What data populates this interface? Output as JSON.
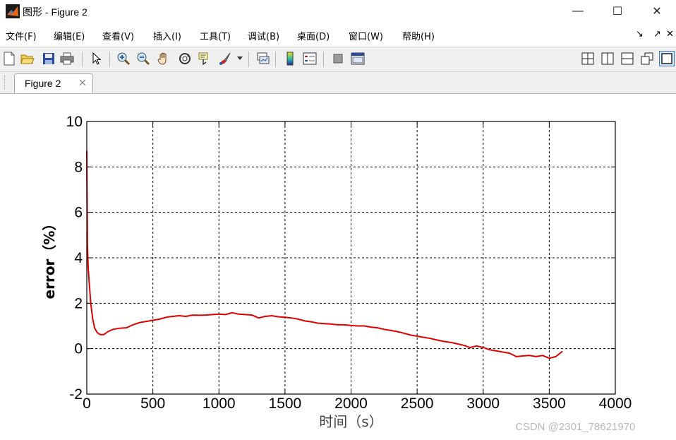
{
  "window": {
    "title": "图形 - Figure 2",
    "minimize_label": "—",
    "maximize_label": "☐",
    "close_label": "✕"
  },
  "menu": {
    "items": [
      "文件(F)",
      "编辑(E)",
      "查看(V)",
      "插入(I)",
      "工具(T)",
      "调试(B)",
      "桌面(D)",
      "窗口(W)",
      "帮助(H)"
    ],
    "right_icons": [
      "↘",
      "↗",
      "✕"
    ]
  },
  "toolbar": {
    "buttons": [
      "new-figure-icon",
      "open-file-icon",
      "save-icon",
      "print-icon",
      "edit-plot-icon",
      "zoom-in-icon",
      "zoom-out-icon",
      "pan-icon",
      "rotate-3d-icon",
      "data-cursor-icon",
      "brush-icon",
      "dropdown-arrow-icon",
      "link-plot-icon",
      "colorbar-icon",
      "legend-icon",
      "hide-plot-tools-icon",
      "show-plot-tools-icon"
    ],
    "layout_buttons": [
      "tile-icon",
      "left-right-icon",
      "top-bottom-icon",
      "float-icon",
      "maximize-icon"
    ]
  },
  "tab": {
    "label": "Figure 2",
    "close_label": "✕"
  },
  "watermark": "CSDN @2301_78621970",
  "chart_data": {
    "type": "line",
    "title": "",
    "xlabel": "时间（s）",
    "ylabel": "error（%）",
    "xlim": [
      0,
      4000
    ],
    "ylim": [
      -2,
      10
    ],
    "xticks": [
      0,
      500,
      1000,
      1500,
      2000,
      2500,
      3000,
      3500,
      4000
    ],
    "yticks": [
      -2,
      0,
      2,
      4,
      6,
      8,
      10
    ],
    "grid": true,
    "grid_style": "dashed",
    "line_color": "#e00000",
    "series": [
      {
        "x": [
          0,
          5,
          10,
          20,
          30,
          45,
          60,
          80,
          100,
          130,
          160,
          200,
          250,
          300,
          350,
          400,
          450,
          500,
          550,
          600,
          650,
          700,
          750,
          800,
          850,
          900,
          950,
          1000,
          1050,
          1100,
          1150,
          1200,
          1250,
          1300,
          1350,
          1400,
          1450,
          1500,
          1550,
          1600,
          1650,
          1700,
          1750,
          1800,
          1850,
          1900,
          1950,
          2000,
          2050,
          2100,
          2150,
          2200,
          2250,
          2300,
          2350,
          2400,
          2450,
          2500,
          2550,
          2600,
          2650,
          2700,
          2750,
          2800,
          2850,
          2900,
          2950,
          3000,
          3050,
          3100,
          3150,
          3200,
          3250,
          3300,
          3350,
          3400,
          3450,
          3500,
          3550,
          3600
        ],
        "y": [
          8.7,
          4.5,
          3.6,
          2.8,
          2.0,
          1.3,
          0.9,
          0.7,
          0.62,
          0.62,
          0.75,
          0.85,
          0.9,
          0.92,
          1.05,
          1.15,
          1.2,
          1.25,
          1.3,
          1.38,
          1.42,
          1.45,
          1.42,
          1.48,
          1.47,
          1.48,
          1.5,
          1.52,
          1.5,
          1.58,
          1.52,
          1.5,
          1.48,
          1.35,
          1.42,
          1.45,
          1.4,
          1.38,
          1.35,
          1.3,
          1.22,
          1.18,
          1.12,
          1.1,
          1.08,
          1.05,
          1.05,
          1.02,
          1.0,
          1.0,
          0.95,
          0.92,
          0.85,
          0.8,
          0.75,
          0.68,
          0.6,
          0.55,
          0.5,
          0.45,
          0.38,
          0.32,
          0.28,
          0.22,
          0.15,
          0.05,
          0.12,
          0.05,
          -0.05,
          -0.1,
          -0.15,
          -0.2,
          -0.35,
          -0.32,
          -0.3,
          -0.35,
          -0.3,
          -0.42,
          -0.35,
          -0.12
        ]
      }
    ]
  }
}
